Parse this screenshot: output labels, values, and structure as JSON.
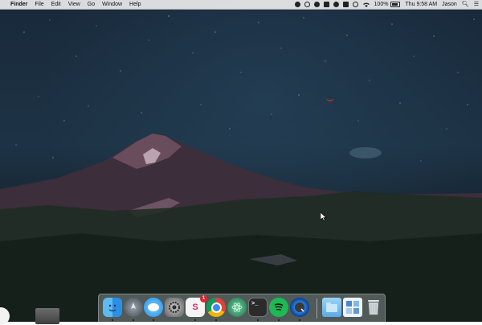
{
  "menubar": {
    "apple_glyph": "",
    "app_name": "Finder",
    "menus": [
      "File",
      "Edit",
      "View",
      "Go",
      "Window",
      "Help"
    ],
    "status": {
      "battery": "100%",
      "time": "Thu 9:58 AM",
      "user": "Jason"
    }
  },
  "dock": {
    "apps": [
      {
        "name": "Finder"
      },
      {
        "name": "Launchpad"
      },
      {
        "name": "Messages"
      },
      {
        "name": "System Preferences"
      },
      {
        "name": "Slack",
        "badge": "1"
      },
      {
        "name": "Chrome"
      },
      {
        "name": "Atom"
      },
      {
        "name": "Terminal"
      },
      {
        "name": "Spotify"
      },
      {
        "name": "QuickTime Player"
      },
      {
        "name": "Downloads"
      },
      {
        "name": "Documents"
      },
      {
        "name": "Trash"
      }
    ]
  },
  "icons": {
    "slack_letter": "S",
    "terminal_prompt": ">_"
  }
}
